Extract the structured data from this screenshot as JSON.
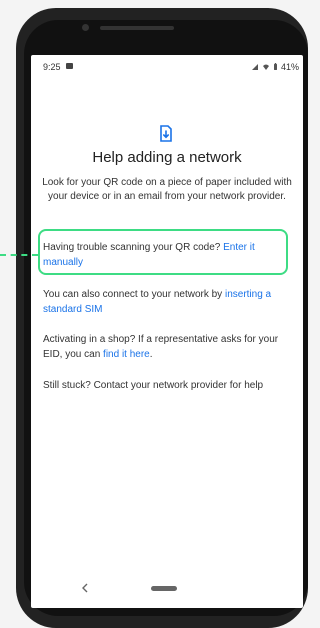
{
  "status_bar": {
    "time": "9:25",
    "battery": "41%"
  },
  "page": {
    "title": "Help adding a network",
    "subtitle": "Look for your QR code on a piece of paper included with your device or in an email from your network provider.",
    "trouble": {
      "prefix": "Having trouble scanning your QR code?",
      "link": "Enter it manually"
    },
    "sim": {
      "prefix": "You can also connect to your network by",
      "link": "inserting a standard SIM"
    },
    "eid": {
      "prefix": "Activating in a shop? If a representative asks for your EID, you can",
      "link": "find it here",
      "suffix": "."
    },
    "support": "Still stuck? Contact your network provider for help"
  },
  "colors": {
    "accent": "#1a73e8",
    "highlight": "#3ddc84"
  },
  "icons": {
    "header": "download-sim-icon",
    "back": "back-chevron-icon",
    "home": "home-pill-icon",
    "status": [
      "app-notification-icon",
      "signal-icon",
      "wifi-icon",
      "battery-icon"
    ]
  }
}
